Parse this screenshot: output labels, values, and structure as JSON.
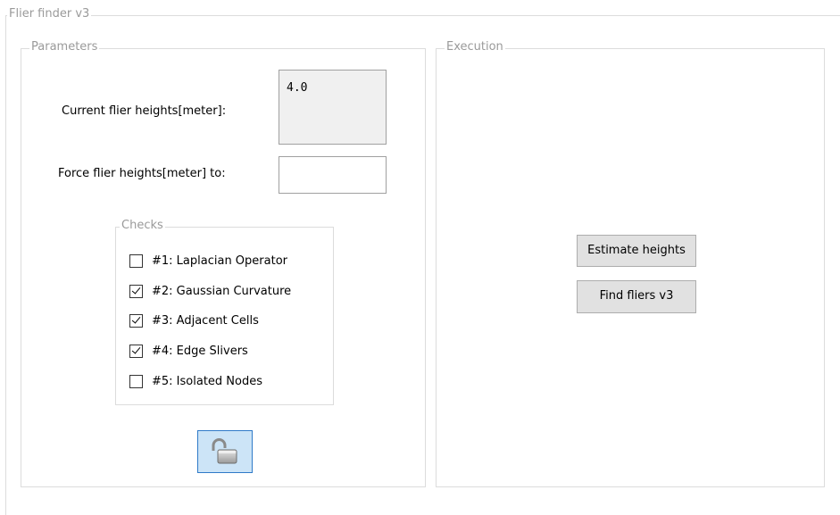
{
  "window": {
    "group_title": "Flier finder v3"
  },
  "parameters": {
    "legend": "Parameters",
    "current_label": "Current flier heights[meter]:",
    "current_value": "4.0",
    "force_label": "Force flier heights[meter] to:",
    "force_value": ""
  },
  "checks": {
    "legend": "Checks",
    "items": [
      {
        "label": "#1: Laplacian Operator",
        "checked": false
      },
      {
        "label": "#2: Gaussian Curvature",
        "checked": true
      },
      {
        "label": "#3: Adjacent Cells",
        "checked": true
      },
      {
        "label": "#4: Edge Slivers",
        "checked": true
      },
      {
        "label": "#5: Isolated Nodes",
        "checked": false
      }
    ]
  },
  "lock_button": {
    "icon": "unlocked-padlock-icon",
    "state": "unlocked"
  },
  "execution": {
    "legend": "Execution",
    "estimate_label": "Estimate heights",
    "find_label": "Find fliers v3"
  },
  "colors": {
    "border": "#dcdcdc",
    "legend_text": "#9a9a9a",
    "readonly_bg": "#f0f0f0",
    "button_bg": "#e1e1e1",
    "lock_bg": "#cce4f7",
    "lock_border": "#2f7ac8"
  }
}
